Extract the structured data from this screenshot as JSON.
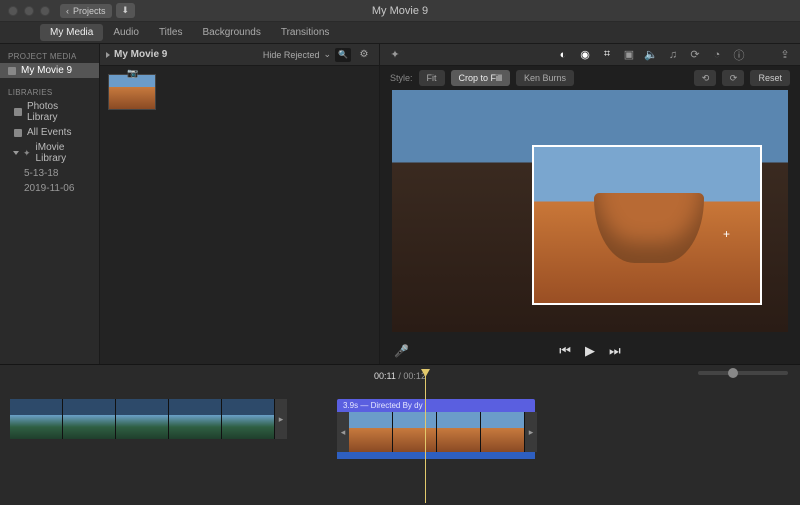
{
  "titlebar": {
    "back_label": "Projects",
    "window_title": "My Movie 9"
  },
  "tabs": {
    "my_media": "My Media",
    "audio": "Audio",
    "titles": "Titles",
    "backgrounds": "Backgrounds",
    "transitions": "Transitions",
    "active": "my_media"
  },
  "sidebar": {
    "project_header": "PROJECT MEDIA",
    "project_name": "My Movie 9",
    "libraries_header": "LIBRARIES",
    "photos_library": "Photos Library",
    "all_events": "All Events",
    "imovie_library": "iMovie Library",
    "event1": "5-13-18",
    "event2": "2019-11-06"
  },
  "browser": {
    "title": "My Movie 9",
    "filter_label": "Hide Rejected",
    "search_placeholder": ""
  },
  "crop": {
    "style_label": "Style:",
    "fit": "Fit",
    "crop_to_fill": "Crop to Fill",
    "ken_burns": "Ken Burns",
    "reset": "Reset"
  },
  "timeline": {
    "current": "00:11",
    "total": "00:12",
    "clip_title": "3.9s — Directed By dy"
  },
  "icons": {
    "wand": "✦",
    "balance": "◐",
    "color": "◉",
    "crop": "⌗",
    "stabilize": "▣",
    "volume": "🔈",
    "noise": "♫",
    "speed": "⟳",
    "info": "ⓘ",
    "filter": "◔",
    "rotate_l": "⟲",
    "rotate_r": "⟳",
    "mic": "🎤",
    "prev": "⏮",
    "play": "▶",
    "next": "⏭"
  }
}
